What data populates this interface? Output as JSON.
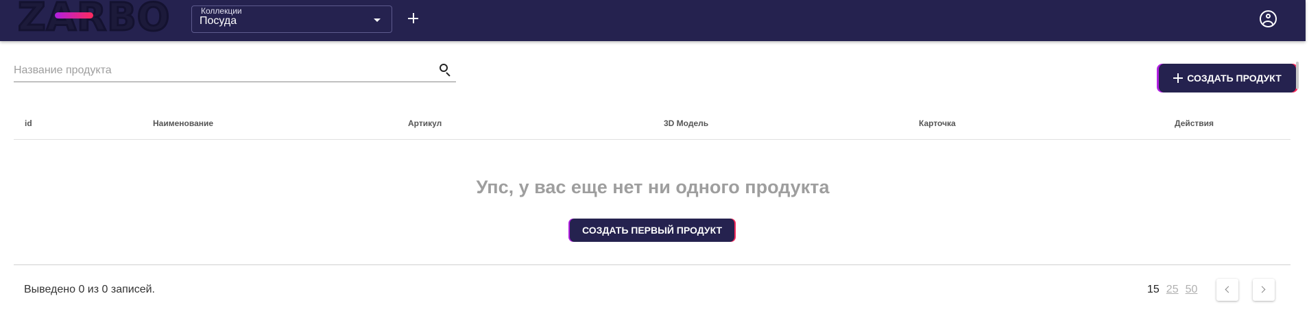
{
  "header": {
    "logo_text": "ZARBO",
    "collection_caption": "Коллекции",
    "collection_value": "Посуда"
  },
  "search": {
    "placeholder": "Название продукта"
  },
  "actions": {
    "create_product": "СОЗДАТЬ ПРОДУКТ"
  },
  "table": {
    "columns": [
      "id",
      "Наименование",
      "Артикул",
      "3D Модель",
      "Карточка",
      "Действия"
    ]
  },
  "empty_state": {
    "message": "Упс, у вас еще нет ни одного продукта",
    "button": "СОЗДАТЬ ПЕРВЫЙ ПРОДУКТ"
  },
  "footer": {
    "records_info": "Выведено 0 из 0 записей.",
    "page_sizes": [
      "15",
      "25",
      "50"
    ],
    "active_page_size": "15"
  },
  "colors": {
    "primary": "#25224f",
    "accent_left": "#b01fe0",
    "accent_right": "#ff2a5c"
  }
}
